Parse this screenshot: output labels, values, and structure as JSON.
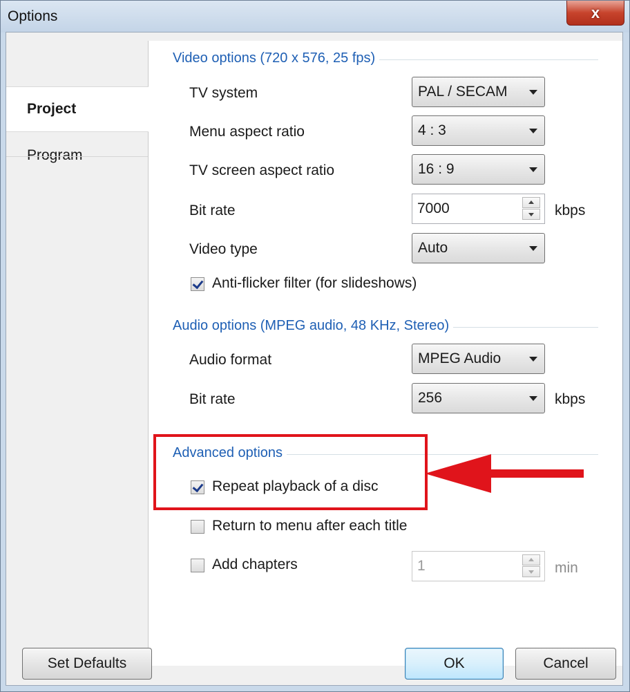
{
  "window": {
    "title": "Options",
    "close_glyph": "x"
  },
  "nav": {
    "items": [
      {
        "label": "Project",
        "selected": true
      },
      {
        "label": "Program",
        "selected": false
      }
    ]
  },
  "video": {
    "title": "Video options (720 x 576, 25 fps)",
    "tv_system": {
      "label": "TV system",
      "value": "PAL / SECAM"
    },
    "menu_aspect": {
      "label": "Menu aspect ratio",
      "value": "4 : 3"
    },
    "tv_aspect": {
      "label": "TV screen aspect ratio",
      "value": "16 : 9"
    },
    "bit_rate": {
      "label": "Bit rate",
      "value": "7000",
      "unit": "kbps"
    },
    "video_type": {
      "label": "Video type",
      "value": "Auto"
    },
    "anti_flicker": {
      "label": "Anti-flicker filter (for slideshows)",
      "checked": true
    }
  },
  "audio": {
    "title": "Audio options (MPEG audio, 48 KHz, Stereo)",
    "format": {
      "label": "Audio format",
      "value": "MPEG Audio"
    },
    "bit_rate": {
      "label": "Bit rate",
      "value": "256",
      "unit": "kbps"
    }
  },
  "advanced": {
    "title": "Advanced options",
    "repeat": {
      "label": "Repeat playback of a disc",
      "checked": true
    },
    "return_menu": {
      "label": "Return to menu after each title",
      "checked": false
    },
    "chapters": {
      "label": "Add chapters",
      "checked": false,
      "value": "1",
      "unit": "min"
    }
  },
  "buttons": {
    "set_defaults": "Set Defaults",
    "ok": "OK",
    "cancel": "Cancel"
  },
  "annotation": {
    "box_color": "#e0141b",
    "arrow_color": "#e0141b"
  }
}
